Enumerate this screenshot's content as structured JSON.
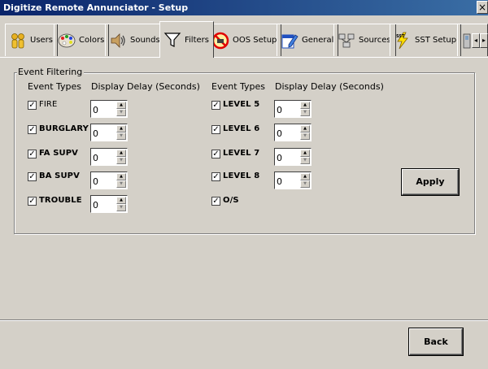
{
  "window": {
    "title": "Digitize Remote Annunciator - Setup",
    "close_label": "×"
  },
  "tabs": [
    {
      "label": "Users",
      "icon": "users-icon"
    },
    {
      "label": "Colors",
      "icon": "palette-icon"
    },
    {
      "label": "Sounds",
      "icon": "speaker-icon"
    },
    {
      "label": "Filters",
      "icon": "filter-icon",
      "active": true
    },
    {
      "label": "OOS Setup",
      "icon": "no-entry-icon"
    },
    {
      "label": "General",
      "icon": "edit-icon"
    },
    {
      "label": "Sources",
      "icon": "network-icon"
    },
    {
      "label": "SST Setup",
      "icon": "lightning-icon"
    }
  ],
  "tab_scroll": {
    "left": "◂",
    "right": "▸"
  },
  "group": {
    "label": "Event Filtering",
    "header_event_types": "Event Types",
    "header_display_delay": "Display Delay (Seconds)"
  },
  "left_events": [
    {
      "label": "FIRE",
      "checked": true,
      "delay": "0"
    },
    {
      "label": "BURGLARY",
      "checked": true,
      "delay": "0"
    },
    {
      "label": "FA SUPV",
      "checked": true,
      "delay": "0"
    },
    {
      "label": "BA SUPV",
      "checked": true,
      "delay": "0"
    },
    {
      "label": "TROUBLE",
      "checked": true,
      "delay": "0"
    }
  ],
  "right_events": [
    {
      "label": "LEVEL 5",
      "checked": true,
      "delay": "0"
    },
    {
      "label": "LEVEL 6",
      "checked": true,
      "delay": "0"
    },
    {
      "label": "LEVEL 7",
      "checked": true,
      "delay": "0"
    },
    {
      "label": "LEVEL 8",
      "checked": true,
      "delay": "0"
    },
    {
      "label": "O/S",
      "checked": true
    }
  ],
  "checkmark": "✓",
  "spin_up": "▲",
  "spin_down": "▼",
  "buttons": {
    "apply": "Apply",
    "back": "Back"
  }
}
